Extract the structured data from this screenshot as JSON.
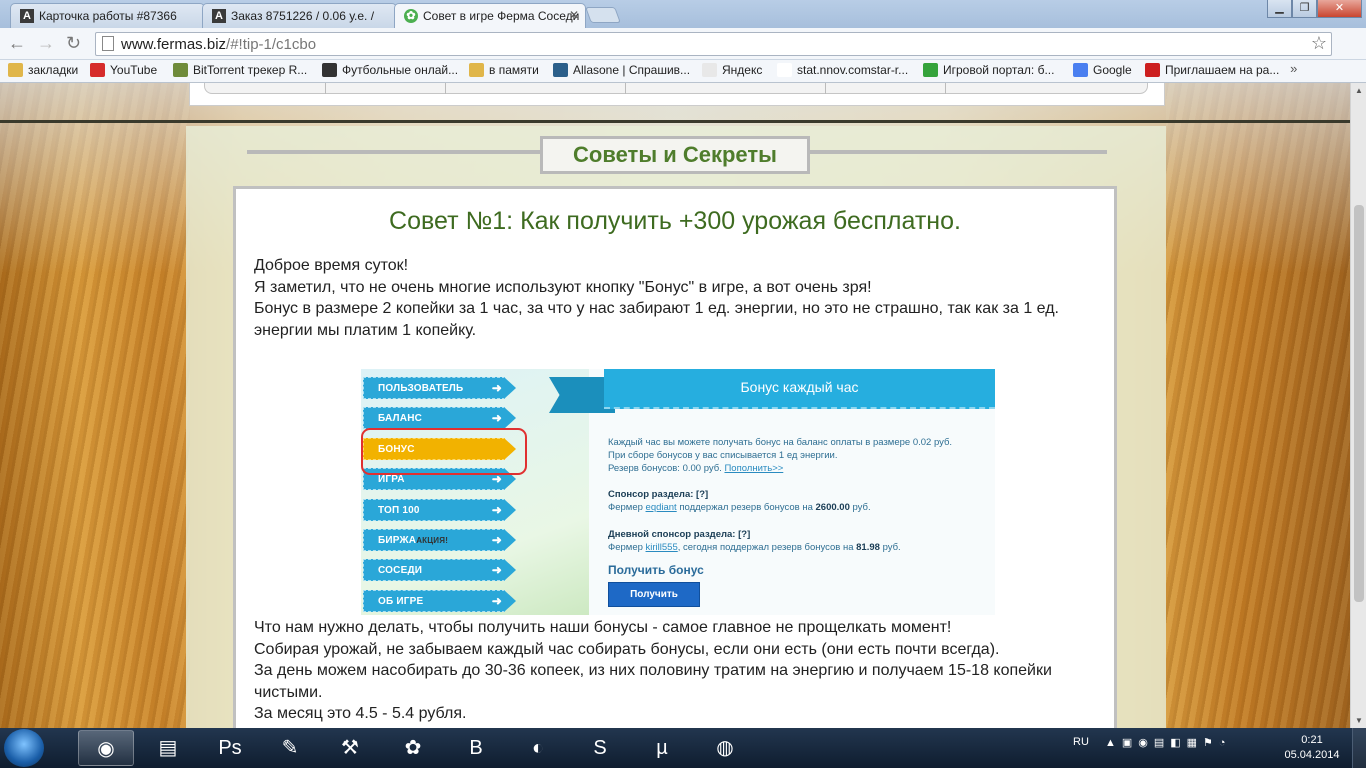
{
  "browser": {
    "tabs": [
      {
        "label": "Карточка работы #87366",
        "icon": "A"
      },
      {
        "label": "Заказ 8751226 / 0.06 у.е. /",
        "icon": "A"
      },
      {
        "label": "Совет в игре Ферма Соседи",
        "icon": "leaf"
      }
    ],
    "url_host": "www.fermas.biz",
    "url_path": "/#!tip-1/c1cbo",
    "bookmarks": [
      {
        "label": "закладки",
        "icon": "folder-icon",
        "color": "#e0b64a"
      },
      {
        "label": "YouTube",
        "icon": "youtube-icon",
        "color": "#d62b2b"
      },
      {
        "label": "BitTorrent трекер R...",
        "icon": "torrent-icon",
        "color": "#6f8b3a"
      },
      {
        "label": "Футбольные онлай...",
        "icon": "football-icon",
        "color": "#333333"
      },
      {
        "label": "в памяти",
        "icon": "folder-icon",
        "color": "#e0b64a"
      },
      {
        "label": "Allasone | Спрашив...",
        "icon": "allasone-icon",
        "color": "#2b5f8a"
      },
      {
        "label": "Яндекс",
        "icon": "yandex-icon",
        "color": "#e8e8e8"
      },
      {
        "label": "stat.nnov.comstar-r...",
        "icon": "page-icon",
        "color": "#ffffff"
      },
      {
        "label": "Игровой портал: б...",
        "icon": "game-portal-icon",
        "color": "#35a33b"
      },
      {
        "label": "Google",
        "icon": "google-icon",
        "color": "#4a7ff0"
      },
      {
        "label": "Приглашаем на ра...",
        "icon": "star-icon",
        "color": "#cc1f1f"
      }
    ],
    "more_bookmarks": "»"
  },
  "page": {
    "section_header": "Советы и Секреты",
    "article_title": "Совет №1: Как получить +300 урожая бесплатно.",
    "intro_lines": [
      "Доброе время суток!",
      "Я заметил, что не очень многие используют кнопку \"Бонус\" в игре, а вот очень зря!",
      "Бонус в размере 2 копейки за 1 час, за что у нас забирают 1 ед. энергии, но это не страшно, так как за 1 ед.",
      "энергии мы платим 1 копейку."
    ],
    "outro_lines": [
      "Что нам нужно делать, чтобы получить наши бонусы - самое главное не прощелкать момент!",
      "Собирая урожай, не забываем каждый час собирать бонусы, если они есть (они есть почти всегда).",
      "За день можем насобирать до 30-36 копеек, из них половину тратим на энергию и получаем 15-18 копейки",
      "чистыми.",
      "За месяц это 4.5 - 5.4 рубля."
    ]
  },
  "screenshot": {
    "menu": [
      {
        "label": "ПОЛЬЗОВАТЕЛЬ",
        "active": false
      },
      {
        "label": "БАЛАНС",
        "active": false
      },
      {
        "label": "БОНУС",
        "active": true
      },
      {
        "label": "ИГРА",
        "active": false
      },
      {
        "label": "ТОП 100",
        "active": false
      },
      {
        "label": "БИРЖА",
        "badge": "АКЦИЯ!",
        "active": false
      },
      {
        "label": "СОСЕДИ",
        "active": false
      },
      {
        "label": "ОБ ИГРЕ",
        "active": false
      }
    ],
    "ribbon_title": "Бонус каждый час",
    "info_line1": "Каждый час вы можете получать бонус на баланс оплаты в размере 0.02 руб.",
    "info_line2": "При сборе бонусов у вас списывается 1 ед энергии.",
    "reserve_prefix": "Резерв бонусов: 0.00 руб.",
    "reserve_link": "Пополнить>>",
    "sponsor_title": "Спонсор раздела:",
    "help_mark": "[?]",
    "sponsor_prefix": "Фермер",
    "sponsor_name": "eqdiant",
    "sponsor_suffix": "поддержал резерв бонусов на",
    "sponsor_amount": "2600.00",
    "daily_title": "Дневной спонсор раздела:",
    "daily_name": "kirill555",
    "daily_suffix": ", сегодня поддержал резерв бонусов на",
    "daily_amount": "81.98",
    "currency": "руб.",
    "get_title": "Получить бонус",
    "get_button": "Получить"
  },
  "taskbar": {
    "apps": [
      {
        "name": "chrome",
        "icon": "◉",
        "open": true
      },
      {
        "name": "explorer",
        "icon": "▤",
        "open": false
      },
      {
        "name": "photoshop",
        "icon": "Ps",
        "open": false
      },
      {
        "name": "pen-tool",
        "icon": "✎",
        "open": false
      },
      {
        "name": "tools",
        "icon": "⚒",
        "open": false
      },
      {
        "name": "icq",
        "icon": "✿",
        "open": false
      },
      {
        "name": "b-app",
        "icon": "B",
        "open": false
      },
      {
        "name": "mouse-app",
        "icon": "◐",
        "open": false
      },
      {
        "name": "skype",
        "icon": "S",
        "open": false
      },
      {
        "name": "utorrent",
        "icon": "µ",
        "open": false
      },
      {
        "name": "google-earth",
        "icon": "◍",
        "open": false
      }
    ],
    "language": "RU",
    "time": "0:21",
    "date": "05.04.2014"
  }
}
